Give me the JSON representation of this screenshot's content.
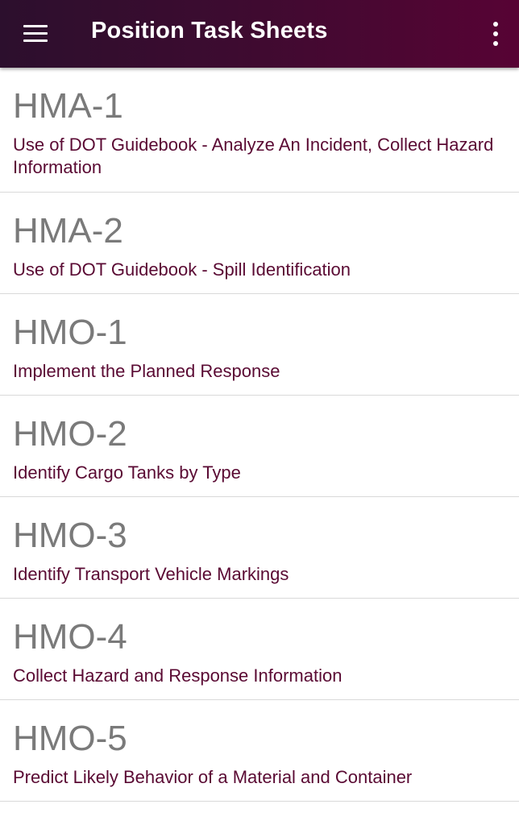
{
  "appbar": {
    "title": "Position Task Sheets",
    "menu_icon": "hamburger-menu-icon",
    "overflow_icon": "more-vertical-icon",
    "colors": {
      "gradient_start": "#2c0f2d",
      "gradient_end": "#570334",
      "text": "#ffffff"
    }
  },
  "list": {
    "colors": {
      "code_text": "#7a7a7a",
      "description_text": "#5a0a33",
      "divider": "#d9d9d9"
    },
    "items": [
      {
        "code": "HMA-1",
        "description": "Use of DOT Guidebook - Analyze An Incident, Collect Hazard Information"
      },
      {
        "code": "HMA-2",
        "description": "Use of DOT Guidebook - Spill Identification"
      },
      {
        "code": "HMO-1",
        "description": "Implement the Planned Response"
      },
      {
        "code": "HMO-2",
        "description": "Identify Cargo Tanks by Type"
      },
      {
        "code": "HMO-3",
        "description": "Identify Transport Vehicle Markings"
      },
      {
        "code": "HMO-4",
        "description": "Collect Hazard and Response Information"
      },
      {
        "code": "HMO-5",
        "description": "Predict Likely Behavior of a Material and Container"
      }
    ]
  }
}
